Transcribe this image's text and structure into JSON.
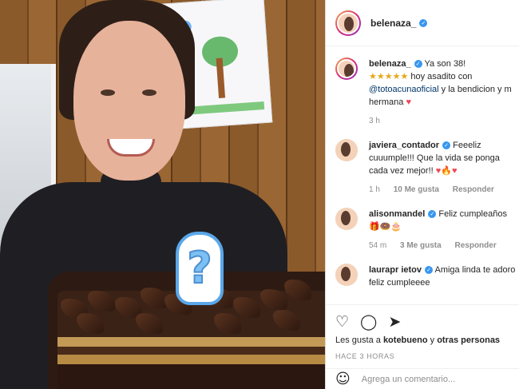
{
  "header": {
    "username": "belenaza_"
  },
  "caption": {
    "username": "belenaza_",
    "text1": "Ya son 38!",
    "stars": "★★★★★",
    "text2": "hoy asadito con",
    "mention": "@totoacunaoficial",
    "text3": "y la bendicion y m hermana",
    "heart": "♥",
    "time": "3 h"
  },
  "comments": [
    {
      "username": "javiera_contador",
      "text": "Feeeliz cuuumple!!! Que la vida se ponga cada vez mejor!!",
      "emojis": "♥🔥♥",
      "time": "1 h",
      "likes": "10 Me gusta",
      "reply": "Responder"
    },
    {
      "username": "alisonmandel",
      "text": "Feliz cumpleaños",
      "emojis": "🎁🍩🎂",
      "time": "54 m",
      "likes": "3 Me gusta",
      "reply": "Responder"
    },
    {
      "username": "laurapr ietov",
      "text": "Amiga linda te adoro feliz cumpleeee"
    }
  ],
  "actions": {
    "likes_prefix": "Les gusta a",
    "liker": "kotebueno",
    "likes_mid": "y",
    "others": "otras personas",
    "timestamp": "HACE 3 HORAS",
    "comment_placeholder": "Agrega un comentario..."
  },
  "photo": {
    "candle_symbol": "?"
  }
}
